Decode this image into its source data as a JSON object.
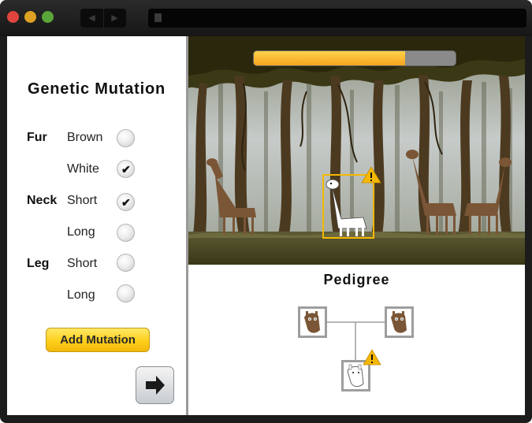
{
  "mutation_panel": {
    "title": "Genetic Mutation",
    "traits": [
      {
        "name": "Fur",
        "options": [
          {
            "label": "Brown",
            "checked": false
          },
          {
            "label": "White",
            "checked": true
          }
        ]
      },
      {
        "name": "Neck",
        "options": [
          {
            "label": "Short",
            "checked": true
          },
          {
            "label": "Long",
            "checked": false
          }
        ]
      },
      {
        "name": "Leg",
        "options": [
          {
            "label": "Short",
            "checked": false
          },
          {
            "label": "Long",
            "checked": false
          }
        ]
      }
    ],
    "add_button": "Add Mutation",
    "check_glyph": "✔",
    "next_icon": "arrow-right-icon"
  },
  "scene": {
    "progress_fraction": 0.75,
    "selected_icon": "warning-icon"
  },
  "pedigree": {
    "title": "Pedigree"
  },
  "colors": {
    "progress": "#f5a51d",
    "button": "#ffcf1d",
    "selection": "#f5b800",
    "warning": "#f5b800"
  }
}
